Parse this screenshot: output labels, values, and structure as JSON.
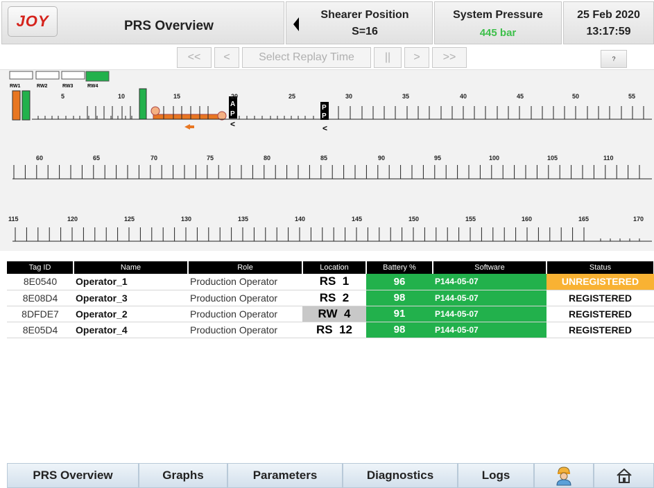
{
  "header": {
    "logo_text": "JOY",
    "title": "PRS Overview",
    "shearer_label": "Shearer Position",
    "shearer_value": "S=16",
    "pressure_label": "System Pressure",
    "pressure_value": "445 bar",
    "date": "25 Feb 2020",
    "time": "13:17:59"
  },
  "replay": {
    "first": "<<",
    "prev": "<",
    "select": "Select Replay Time",
    "pause": "||",
    "next": ">",
    "last": ">>",
    "help": "?"
  },
  "track": {
    "rw_labels": [
      "RW1",
      "RW2",
      "RW3",
      "RW4"
    ],
    "row1_numbers": [
      "5",
      "10",
      "15",
      "20",
      "25",
      "30",
      "35",
      "40",
      "45",
      "50",
      "55"
    ],
    "row2_numbers": [
      "60",
      "65",
      "70",
      "75",
      "80",
      "85",
      "90",
      "95",
      "100",
      "105",
      "110"
    ],
    "row3_numbers": [
      "115",
      "120",
      "125",
      "130",
      "135",
      "140",
      "145",
      "150",
      "155",
      "160",
      "165",
      "170"
    ],
    "tag_a": "A",
    "tag_p": "P",
    "tag_p2": "P",
    "tag_p3": "P",
    "arrow": "<",
    "arrow2": "<"
  },
  "table": {
    "headers": [
      "Tag ID",
      "Name",
      "Role",
      "Location",
      "Battery %",
      "Software",
      "Status"
    ],
    "rows": [
      {
        "tag": "8E0540",
        "name": "Operator_1",
        "role": "Production Operator",
        "loc_type": "RS",
        "loc_num": "1",
        "battery": "96",
        "software": "P144-05-07",
        "status": "UNREGISTERED"
      },
      {
        "tag": "8E08D4",
        "name": "Operator_3",
        "role": "Production Operator",
        "loc_type": "RS",
        "loc_num": "2",
        "battery": "98",
        "software": "P144-05-07",
        "status": "REGISTERED"
      },
      {
        "tag": "8DFDE7",
        "name": "Operator_2",
        "role": "Production Operator",
        "loc_type": "RW",
        "loc_num": "4",
        "battery": "91",
        "software": "P144-05-07",
        "status": "REGISTERED"
      },
      {
        "tag": "8E05D4",
        "name": "Operator_4",
        "role": "Production Operator",
        "loc_type": "RS",
        "loc_num": "12",
        "battery": "98",
        "software": "P144-05-07",
        "status": "REGISTERED"
      }
    ]
  },
  "footer": {
    "tabs": [
      "PRS Overview",
      "Graphs",
      "Parameters",
      "Diagnostics",
      "Logs"
    ]
  },
  "colors": {
    "green": "#22b14c",
    "orange": "#e87722",
    "unregistered": "#f9b233",
    "pressure": "#3dbf4a",
    "logo": "#d5231c"
  }
}
